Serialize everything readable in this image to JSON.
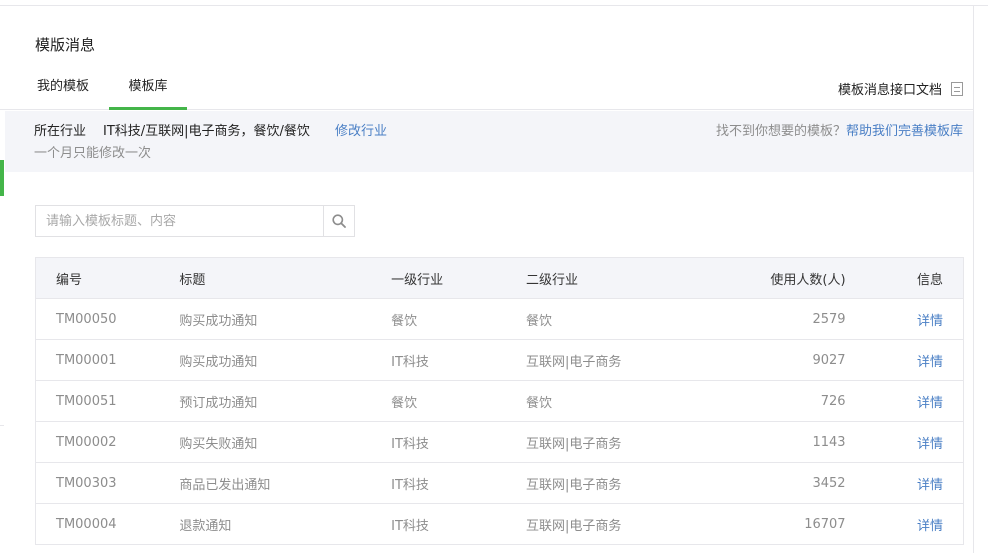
{
  "page": {
    "title": "模版消息"
  },
  "tabs": [
    {
      "label": "我的模板",
      "active": false
    },
    {
      "label": "模板库",
      "active": true
    }
  ],
  "doc_link": {
    "label": "模板消息接口文档",
    "icon": "document-icon"
  },
  "industry": {
    "label": "所在行业",
    "value": "IT科技/互联网|电子商务，餐饮/餐饮",
    "modify_label": "修改行业",
    "note": "一个月只能修改一次",
    "question": "找不到你想要的模板？",
    "help_label": "帮助我们完善模板库"
  },
  "search": {
    "placeholder": "请输入模板标题、内容",
    "value": "",
    "icon": "search-icon"
  },
  "table": {
    "headers": {
      "id": "编号",
      "title": "标题",
      "level1": "一级行业",
      "level2": "二级行业",
      "users": "使用人数(人)",
      "info": "信息"
    },
    "rows": [
      {
        "id": "TM00050",
        "title": "购买成功通知",
        "level1": "餐饮",
        "level2": "餐饮",
        "users": "2579",
        "info": "详情"
      },
      {
        "id": "TM00001",
        "title": "购买成功通知",
        "level1": "IT科技",
        "level2": "互联网|电子商务",
        "users": "9027",
        "info": "详情"
      },
      {
        "id": "TM00051",
        "title": "预订成功通知",
        "level1": "餐饮",
        "level2": "餐饮",
        "users": "726",
        "info": "详情"
      },
      {
        "id": "TM00002",
        "title": "购买失败通知",
        "level1": "IT科技",
        "level2": "互联网|电子商务",
        "users": "1143",
        "info": "详情"
      },
      {
        "id": "TM00303",
        "title": "商品已发出通知",
        "level1": "IT科技",
        "level2": "互联网|电子商务",
        "users": "3452",
        "info": "详情"
      },
      {
        "id": "TM00004",
        "title": "退款通知",
        "level1": "IT科技",
        "level2": "互联网|电子商务",
        "users": "16707",
        "info": "详情"
      }
    ]
  },
  "colors": {
    "accent": "#44b549",
    "link": "#4a7fc5",
    "muted": "#8d8d8d",
    "panel": "#f4f5f9"
  }
}
